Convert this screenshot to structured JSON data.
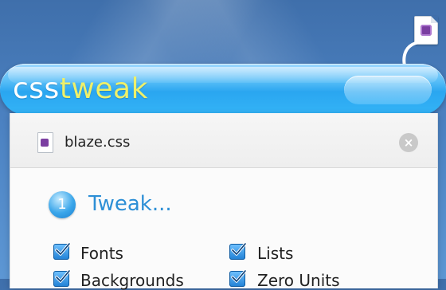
{
  "app": {
    "title_part1": "css",
    "title_part2": "tweak"
  },
  "file": {
    "name": "blaze.css",
    "close_glyph": "×"
  },
  "step": {
    "number": "1",
    "title": "Tweak..."
  },
  "options": [
    {
      "label": "Fonts",
      "checked": true
    },
    {
      "label": "Lists",
      "checked": true
    },
    {
      "label": "Backgrounds",
      "checked": true
    },
    {
      "label": "Zero Units",
      "checked": true
    }
  ],
  "colors": {
    "accent": "#2d8fd6",
    "title_highlight": "#eef06a",
    "file_glyph": "#7b3ea1"
  },
  "icons": {
    "drop_doc": "css-file-icon",
    "drop_arrow": "down-arrow-icon",
    "file": "css-file-icon",
    "close": "close-icon",
    "checkbox": "checkmark-icon"
  }
}
